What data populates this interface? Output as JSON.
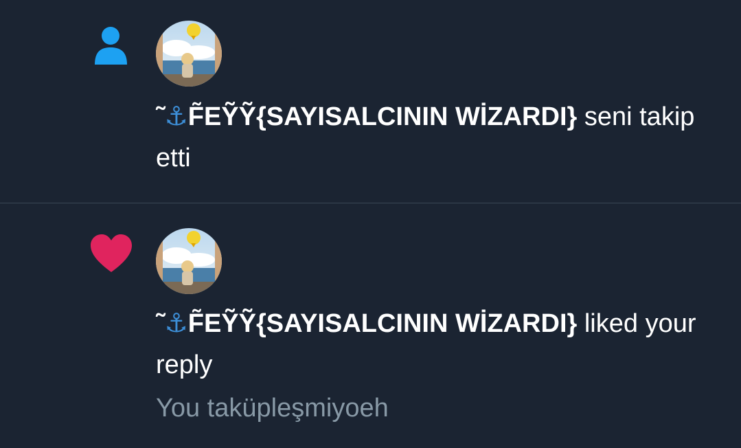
{
  "colors": {
    "background": "#1b2432",
    "follow_icon": "#1da1f2",
    "like_icon": "#e0245e",
    "secondary_text": "#8899a6"
  },
  "notifications": [
    {
      "type": "follow",
      "icon": "person-icon",
      "name_prefix": "˜",
      "name_anchor": "⚓",
      "name": "F̃EỸỸ{SAYISALCININ WİZARDI}",
      "action": "seni takip etti"
    },
    {
      "type": "like",
      "icon": "heart-icon",
      "name_prefix": "˜",
      "name_anchor": "⚓",
      "name": "F̃EỸỸ{SAYISALCININ WİZARDI}",
      "action": "liked your reply",
      "context": "You taküpleşmiyoeh"
    }
  ]
}
